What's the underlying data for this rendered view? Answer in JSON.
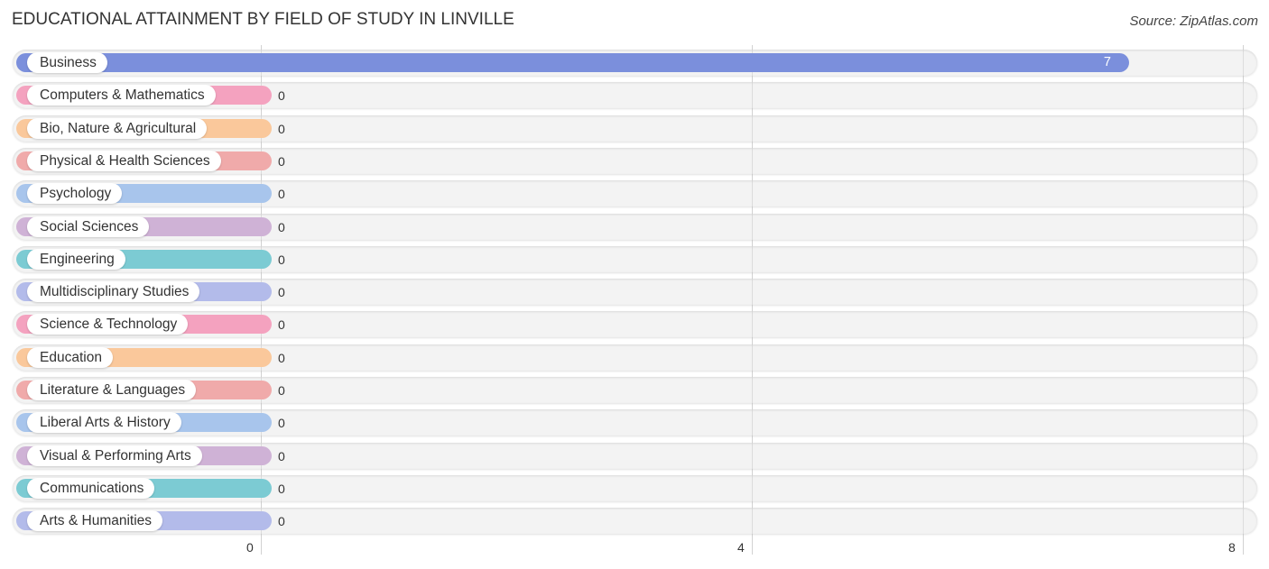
{
  "header": {
    "title": "EDUCATIONAL ATTAINMENT BY FIELD OF STUDY IN LINVILLE",
    "source": "Source: ZipAtlas.com"
  },
  "chart_data": {
    "type": "bar",
    "orientation": "horizontal",
    "title": "EDUCATIONAL ATTAINMENT BY FIELD OF STUDY IN LINVILLE",
    "xlabel": "",
    "ylabel": "",
    "xlim": [
      0,
      8
    ],
    "x_ticks": [
      0,
      4,
      8
    ],
    "x_tick_labels": [
      "0",
      "4",
      "8"
    ],
    "grid": true,
    "categories": [
      "Business",
      "Computers & Mathematics",
      "Bio, Nature & Agricultural",
      "Physical & Health Sciences",
      "Psychology",
      "Social Sciences",
      "Engineering",
      "Multidisciplinary Studies",
      "Science & Technology",
      "Education",
      "Literature & Languages",
      "Liberal Arts & History",
      "Visual & Performing Arts",
      "Communications",
      "Arts & Humanities"
    ],
    "values": [
      7,
      0,
      0,
      0,
      0,
      0,
      0,
      0,
      0,
      0,
      0,
      0,
      0,
      0,
      0
    ],
    "value_labels": [
      "7",
      "0",
      "0",
      "0",
      "0",
      "0",
      "0",
      "0",
      "0",
      "0",
      "0",
      "0",
      "0",
      "0",
      "0"
    ],
    "colors": [
      "#7b8fdc",
      "#f4a2bf",
      "#fac89b",
      "#f0aaaa",
      "#a8c5ec",
      "#cfb2d6",
      "#7ccbd3",
      "#b3bbea",
      "#f4a2bf",
      "#fac89b",
      "#f0aaaa",
      "#a8c5ec",
      "#cfb2d6",
      "#7ccbd3",
      "#b3bbea"
    ]
  }
}
